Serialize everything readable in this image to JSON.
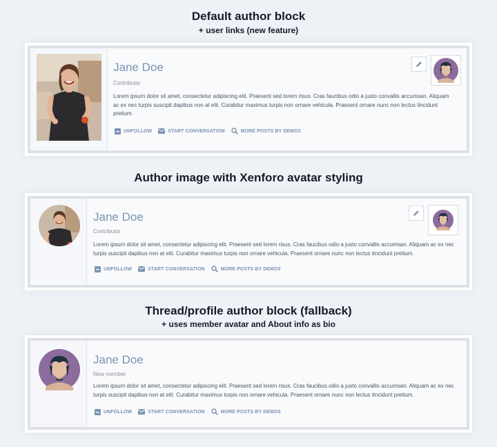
{
  "sections": [
    {
      "title": "Default author block",
      "subtitle": "+ user links (new feature)",
      "author_name": "Jane Doe",
      "role": "Contributor",
      "bio": "Lorem ipsum dolor sit amet, consectetur adipiscing elit. Praesent sed lorem risus. Cras faucibus odio a justo convallis accumsan. Aliquam ac ex nec turpis suscipit dapibus non at elit. Curabitur maximus turpis non ornare vehicula. Praesent ornare nunc non lectus tincidunt pretium.",
      "links": [
        "UNFOLLOW",
        "START CONVERSATION",
        "MORE POSTS BY DEMO3"
      ]
    },
    {
      "title": "Author image with Xenforo avatar styling",
      "author_name": "Jane Doe",
      "role": "Contributor",
      "bio": "Lorem ipsum dolor sit amet, consectetur adipiscing elit. Praesent sed lorem risus. Cras faucibus odio a justo convallis accumsan. Aliquam ac ex nec turpis suscipit dapibus non at elit. Curabitur maximus turpis non ornare vehicula. Praesent ornare nunc non lectus tincidunt pretium.",
      "links": [
        "UNFOLLOW",
        "START CONVERSATION",
        "MORE POSTS BY DEMO3"
      ]
    },
    {
      "title": "Thread/profile author block (fallback)",
      "subtitle": "+ uses member avatar and About info as bio",
      "author_name": "Jane Doe",
      "role": "New member",
      "bio": "Lorem ipsum dolor sit amet, consectetur adipiscing elit. Praesent sed lorem risus. Cras faucibus odio a justo convallis accumsan. Aliquam ac ex nec turpis suscipit dapibus non at elit. Curabitur maximus turpis non ornare vehicula. Praesent ornare nunc non lectus tincidunt pretium.",
      "links": [
        "UNFOLLOW",
        "START CONVERSATION",
        "MORE POSTS BY DEMO3"
      ]
    }
  ],
  "icons": {
    "unfollow": "minus-square-icon",
    "conversation": "envelope-icon",
    "more_posts": "search-icon",
    "edit": "pencil-icon",
    "avatar": "member-avatar-icon"
  },
  "colors": {
    "name": "#7b93b0",
    "link": "#7b93b0",
    "border": "#dde1e6",
    "avatar_bg": "#8c6c9c"
  }
}
